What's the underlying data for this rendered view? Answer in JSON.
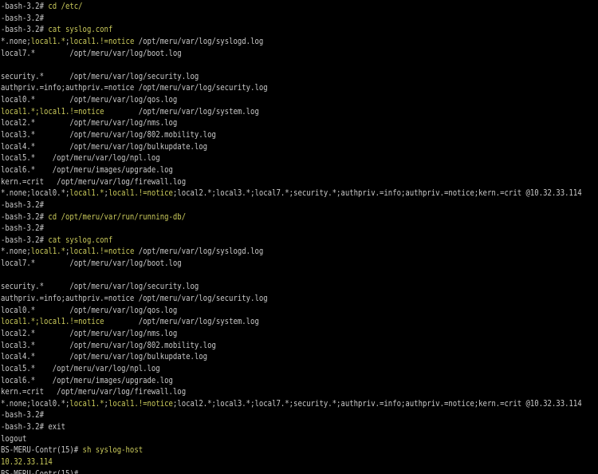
{
  "terminal": {
    "colors": {
      "background": "#000000",
      "text": "#c8c8c8",
      "highlight": "#c8c85a"
    },
    "lines": [
      [
        {
          "t": "-bash-3.2# ",
          "c": "w"
        },
        {
          "t": "cd /etc/",
          "c": "y"
        }
      ],
      [
        {
          "t": "-bash-3.2#",
          "c": "w"
        }
      ],
      [
        {
          "t": "-bash-3.2# ",
          "c": "w"
        },
        {
          "t": "cat syslog.conf",
          "c": "y"
        }
      ],
      [
        {
          "t": "*.none;",
          "c": "w"
        },
        {
          "t": "local1.*",
          "c": "y"
        },
        {
          "t": ";",
          "c": "w"
        },
        {
          "t": "local1.!=notice",
          "c": "y"
        },
        {
          "t": " /opt/meru/var/log/syslogd.log",
          "c": "w"
        }
      ],
      [
        {
          "t": "local7.*        /opt/meru/var/log/boot.log",
          "c": "w"
        }
      ],
      [
        {
          "t": "",
          "c": "w"
        }
      ],
      [
        {
          "t": "security.*      /opt/meru/var/log/security.log",
          "c": "w"
        }
      ],
      [
        {
          "t": "authpriv.=info;authpriv.=notice /opt/meru/var/log/security.log",
          "c": "w"
        }
      ],
      [
        {
          "t": "local0.*        /opt/meru/var/log/qos.log",
          "c": "w"
        }
      ],
      [
        {
          "t": "local1.*;local1.!=notice",
          "c": "y"
        },
        {
          "t": "        /opt/meru/var/log/system.log",
          "c": "w"
        }
      ],
      [
        {
          "t": "local2.*        /opt/meru/var/log/nms.log",
          "c": "w"
        }
      ],
      [
        {
          "t": "local3.*        /opt/meru/var/log/802.mobility.log",
          "c": "w"
        }
      ],
      [
        {
          "t": "local4.*        /opt/meru/var/log/bulkupdate.log",
          "c": "w"
        }
      ],
      [
        {
          "t": "local5.*    /opt/meru/var/log/npl.log",
          "c": "w"
        }
      ],
      [
        {
          "t": "local6.*    /opt/meru/images/upgrade.log",
          "c": "w"
        }
      ],
      [
        {
          "t": "kern.=crit   /opt/meru/var/log/firewall.log",
          "c": "w"
        }
      ],
      [
        {
          "t": "*.none;local0.*;",
          "c": "w"
        },
        {
          "t": "local1.*",
          "c": "y"
        },
        {
          "t": ";",
          "c": "w"
        },
        {
          "t": "local1.!=notice",
          "c": "y"
        },
        {
          "t": ";local2.*;local3.*;local7.*;security.*;authpriv.=info;authpriv.=notice;kern.=crit @10.32.33.114",
          "c": "w"
        }
      ],
      [
        {
          "t": "-bash-3.2#",
          "c": "w"
        }
      ],
      [
        {
          "t": "-bash-3.2# ",
          "c": "w"
        },
        {
          "t": "cd /opt/meru/var/run/running-db/",
          "c": "y"
        }
      ],
      [
        {
          "t": "-bash-3.2#",
          "c": "w"
        }
      ],
      [
        {
          "t": "-bash-3.2# ",
          "c": "w"
        },
        {
          "t": "cat syslog.conf",
          "c": "y"
        }
      ],
      [
        {
          "t": "*.none;",
          "c": "w"
        },
        {
          "t": "local1.*",
          "c": "y"
        },
        {
          "t": ";",
          "c": "w"
        },
        {
          "t": "local1.!=notice",
          "c": "y"
        },
        {
          "t": " /opt/meru/var/log/syslogd.log",
          "c": "w"
        }
      ],
      [
        {
          "t": "local7.*        /opt/meru/var/log/boot.log",
          "c": "w"
        }
      ],
      [
        {
          "t": "",
          "c": "w"
        }
      ],
      [
        {
          "t": "security.*      /opt/meru/var/log/security.log",
          "c": "w"
        }
      ],
      [
        {
          "t": "authpriv.=info;authpriv.=notice /opt/meru/var/log/security.log",
          "c": "w"
        }
      ],
      [
        {
          "t": "local0.*        /opt/meru/var/log/qos.log",
          "c": "w"
        }
      ],
      [
        {
          "t": "local1.*;local1.!=notice",
          "c": "y"
        },
        {
          "t": "        /opt/meru/var/log/system.log",
          "c": "w"
        }
      ],
      [
        {
          "t": "local2.*        /opt/meru/var/log/nms.log",
          "c": "w"
        }
      ],
      [
        {
          "t": "local3.*        /opt/meru/var/log/802.mobility.log",
          "c": "w"
        }
      ],
      [
        {
          "t": "local4.*        /opt/meru/var/log/bulkupdate.log",
          "c": "w"
        }
      ],
      [
        {
          "t": "local5.*    /opt/meru/var/log/npl.log",
          "c": "w"
        }
      ],
      [
        {
          "t": "local6.*    /opt/meru/images/upgrade.log",
          "c": "w"
        }
      ],
      [
        {
          "t": "kern.=crit   /opt/meru/var/log/firewall.log",
          "c": "w"
        }
      ],
      [
        {
          "t": "*.none;local0.*;",
          "c": "w"
        },
        {
          "t": "local1.*",
          "c": "y"
        },
        {
          "t": ";",
          "c": "w"
        },
        {
          "t": "local1.!=notice",
          "c": "y"
        },
        {
          "t": ";local2.*;local3.*;local7.*;security.*;authpriv.=info;authpriv.=notice;kern.=crit @10.32.33.114",
          "c": "w"
        }
      ],
      [
        {
          "t": "-bash-3.2#",
          "c": "w"
        }
      ],
      [
        {
          "t": "-bash-3.2# exit",
          "c": "w"
        }
      ],
      [
        {
          "t": "logout",
          "c": "w"
        }
      ],
      [
        {
          "t": "BS-MERU-Contr(15)# ",
          "c": "w"
        },
        {
          "t": "sh syslog-host",
          "c": "y"
        }
      ],
      [
        {
          "t": "10.32.33.114",
          "c": "y"
        }
      ],
      [
        {
          "t": "BS-MERU-Contr(15)#",
          "c": "w"
        }
      ]
    ]
  }
}
